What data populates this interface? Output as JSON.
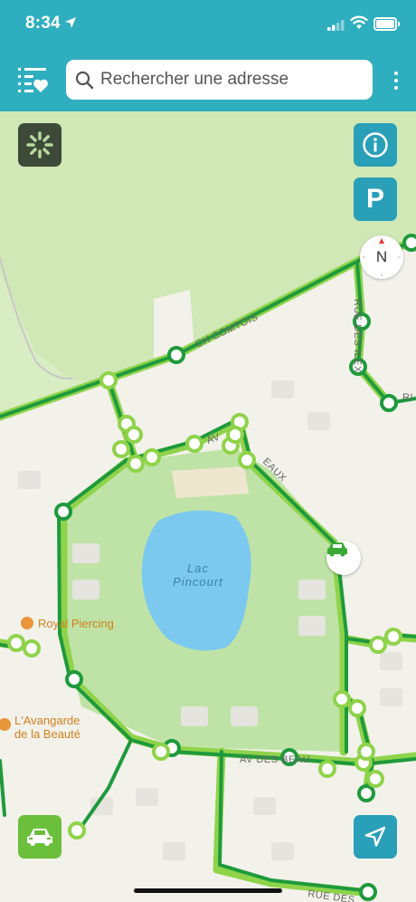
{
  "status_bar": {
    "time": "8:34"
  },
  "search": {
    "placeholder": "Rechercher une adresse"
  },
  "map": {
    "lake_name_line1": "Lac",
    "lake_name_line2": "Pincourt",
    "street_comtois": "CH COMTOIS",
    "street_right": "RUE DES",
    "street_av_beau": "AV DES BEAU",
    "street_bottom": "RUE DES",
    "street_eaux": "EAUX",
    "street_av": "AV",
    "street_right_end": "RI",
    "street_ilexes": "RUE DES ILEX",
    "poi_1": "Royal Piercing",
    "poi_2_line1": "L'Avangarde",
    "poi_2_line2": "de la Beauté",
    "compass_label": "N",
    "parking_label": "P"
  },
  "colors": {
    "header": "#2faec0",
    "map_button": "#2a9fb8",
    "car_button": "#6bbf3a",
    "route_dark": "#1e9a3c",
    "route_light": "#8fd34a",
    "lake": "#7cc9ef",
    "park": "#b9dfa0"
  },
  "icons": [
    "location-arrow-icon",
    "signal-icon",
    "wifi-icon",
    "battery-icon",
    "favorites-list-icon",
    "search-icon",
    "more-vertical-icon",
    "loading-spinner-icon",
    "info-icon",
    "compass-icon",
    "car-icon",
    "navigation-arrow-icon"
  ]
}
